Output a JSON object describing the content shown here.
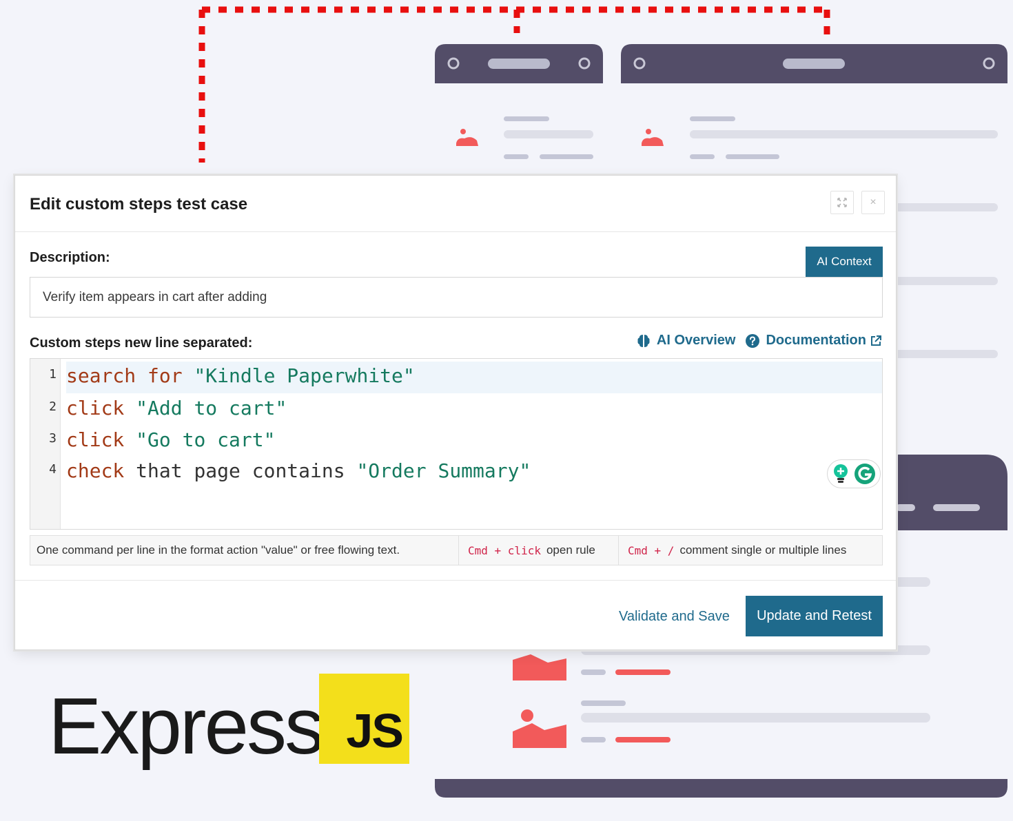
{
  "modal": {
    "title": "Edit custom steps test case",
    "expand_icon": "expand-icon",
    "close_icon": "close-icon",
    "close_glyph": "×"
  },
  "description": {
    "label": "Description:",
    "value": "Verify item appears in cart after adding",
    "ai_context_label": "AI Context"
  },
  "steps": {
    "label": "Custom steps new line separated:",
    "ai_overview_label": "AI Overview",
    "documentation_label": "Documentation",
    "lines": [
      {
        "num": "1",
        "keyword": "search for",
        "plain": "",
        "value": "\"Kindle Paperwhite\""
      },
      {
        "num": "2",
        "keyword": "click",
        "plain": "",
        "value": "\"Add to cart\""
      },
      {
        "num": "3",
        "keyword": "click",
        "plain": "",
        "value": "\"Go to cart\""
      },
      {
        "num": "4",
        "keyword": "check",
        "plain": "that page contains",
        "value": "\"Order Summary\""
      }
    ]
  },
  "hints": {
    "format": "One command per line in the format action \"value\" or free flowing text.",
    "open_rule_keys": "Cmd + click",
    "open_rule_text": "open rule",
    "comment_keys": "Cmd + /",
    "comment_text": "comment single or multiple lines"
  },
  "footer": {
    "validate_label": "Validate and Save",
    "retest_label": "Update and Retest"
  },
  "logo": {
    "express_text": "Express",
    "js_text": "JS"
  },
  "colors": {
    "primary": "#1f6a8c",
    "keyword": "#a23a17",
    "string": "#157a5f",
    "accent_red": "#f25a5a",
    "window_dark": "#534d68",
    "js_yellow": "#f3df1b"
  }
}
